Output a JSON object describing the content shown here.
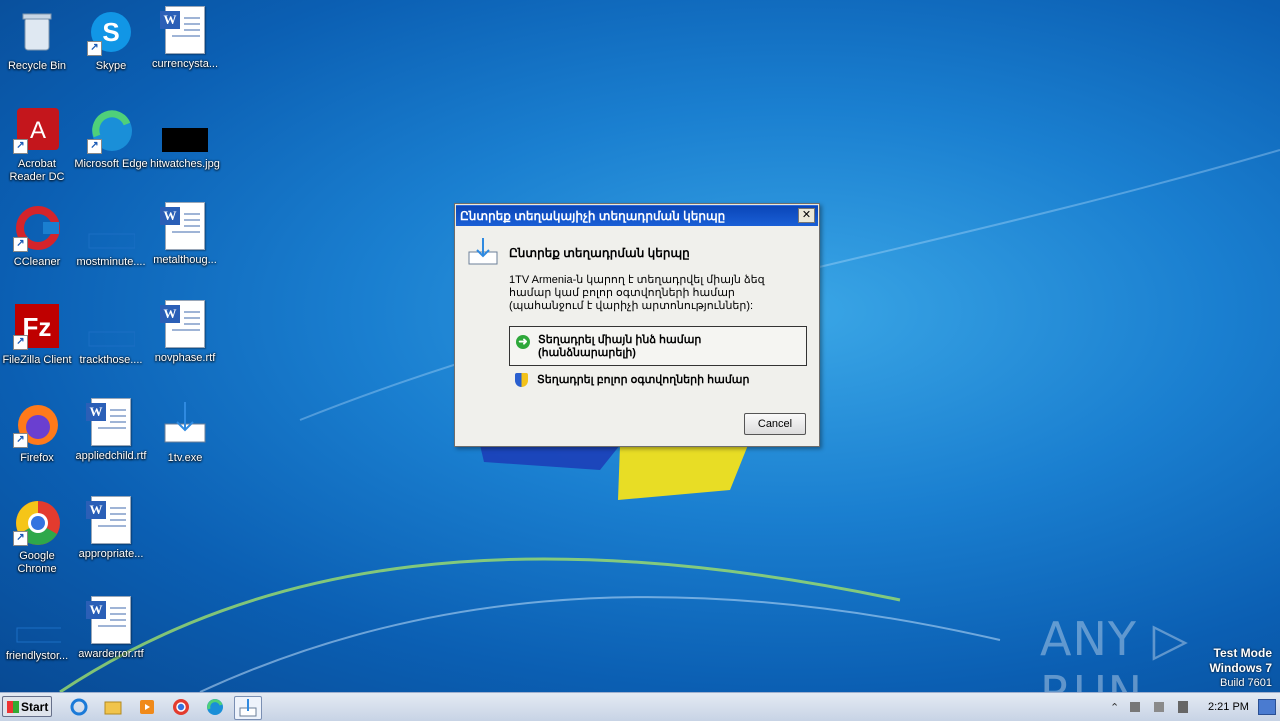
{
  "desktop": {
    "icons": [
      {
        "label": "Recycle Bin"
      },
      {
        "label": "Skype"
      },
      {
        "label": "currencysta..."
      },
      {
        "label": "Acrobat Reader DC"
      },
      {
        "label": "Microsoft Edge"
      },
      {
        "label": "hitwatches.jpg"
      },
      {
        "label": "CCleaner"
      },
      {
        "label": "mostminute...."
      },
      {
        "label": "metalthoug..."
      },
      {
        "label": "FileZilla Client"
      },
      {
        "label": "trackthose...."
      },
      {
        "label": "novphase.rtf"
      },
      {
        "label": "Firefox"
      },
      {
        "label": "appliedchild.rtf"
      },
      {
        "label": "1tv.exe"
      },
      {
        "label": "Google Chrome"
      },
      {
        "label": "appropriate..."
      },
      {
        "label": "friendlystor..."
      },
      {
        "label": "awarderror.rtf"
      }
    ]
  },
  "dialog": {
    "title": "Ընտրեք տեղակայիչի տեղադրման կերպը",
    "close_label": "✕",
    "heading": "Ընտրեք տեղադրման կերպը",
    "description": "1TV Armenia-ն կարող է տեղադրվել միայն ձեզ համար կամ բոլոր օգտվողների համար (պահանջում է վարիչի արտոնություններ):",
    "option_user_line1": "Տեղադրել միայն ինձ համար",
    "option_user_line2": "(հանձնարարելի)",
    "option_all": "Տեղադրել բոլոր օգտվողների համար",
    "cancel_label": "Cancel"
  },
  "taskbar": {
    "start_label": "Start",
    "clock": "2:21 PM"
  },
  "watermark": {
    "line1": "Test Mode",
    "line2": "Windows 7",
    "line3": "Build 7601",
    "brand": "ANY ▷ RUN"
  },
  "colors": {
    "desktop_blue": "#1a7fd0",
    "title_blue": "#0a46b8",
    "dialog_bg": "#f0f0ec"
  }
}
